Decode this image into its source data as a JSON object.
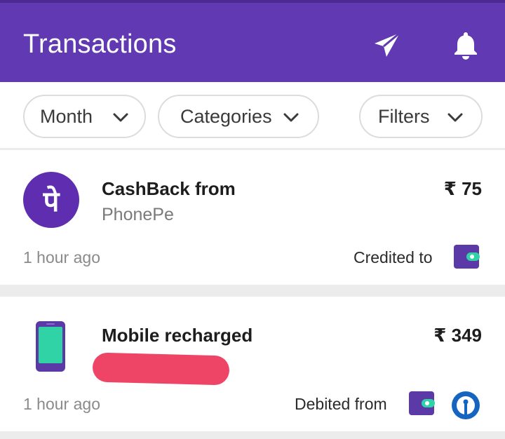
{
  "header": {
    "title": "Transactions",
    "icons": [
      "send-icon",
      "notification-bell-icon"
    ],
    "background_color": "#6039b3"
  },
  "filters": {
    "month_label": "Month",
    "categories_label": "Categories",
    "filters_label": "Filters"
  },
  "transactions": [
    {
      "title": "CashBack from",
      "subtitle": "PhonePe",
      "amount": "₹ 75",
      "time": "1 hour ago",
      "status": "Credited to",
      "logo_glyph": "पे",
      "status_icon": "wallet-icon"
    },
    {
      "title": "Mobile recharged",
      "amount": "₹ 349",
      "time": "1 hour ago",
      "status": "Debited from",
      "status_icons": [
        "wallet-icon",
        "bank-icon"
      ]
    }
  ],
  "colors": {
    "accent": "#6039b3",
    "wallet": "#5b3aa8",
    "wallet_clasp": "#2fd3a6",
    "bank": "#1565c0",
    "redaction": "#ee4566"
  }
}
